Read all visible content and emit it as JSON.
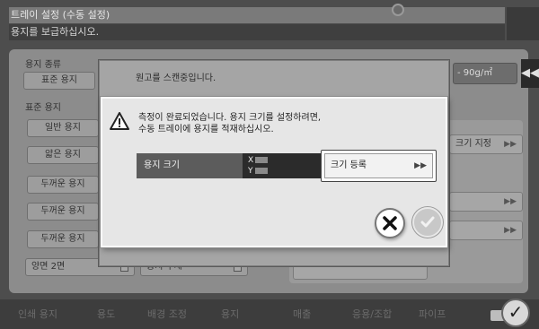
{
  "background": {
    "title": "트레이 설정 (수동 설정)",
    "message": "용지를 보급하십시오.",
    "paper_type_label": "용지 종류",
    "standard_paper_button": "표준 용지",
    "standard_paper_label": "표준 용지",
    "left_buttons": [
      "일반 용지",
      "얇은 용지",
      "두꺼운 용지",
      "두꺼운 용지",
      "두꺼운 용지"
    ],
    "duplex_button": "양면 2면",
    "second_button": "용지 주체",
    "weight_field": "- 90g/㎡",
    "arrow_button": "◀◀",
    "size_specify_button": "크기 지정",
    "small_button_arrow": "▶▶",
    "bottom_tabs": [
      "인쇄 용지",
      "용도",
      "배경 조정",
      "용지",
      "매출",
      "응용/조합",
      "파이프"
    ]
  },
  "scan_dialog": {
    "text": "원고를 스캔중입니다."
  },
  "alert": {
    "message_line1": "측정이 완료되었습니다. 용지 크기를 설정하려면,",
    "message_line2": "수동 트레이에 용지를 적재하십시오.",
    "size_label": "용지 크기",
    "x_label": "X",
    "y_label": "Y",
    "register_button": "크기 등록",
    "register_arrow": "▶▶"
  },
  "icons": {
    "warning": "warning-icon",
    "cancel": "close-icon",
    "ok": "check-icon"
  }
}
